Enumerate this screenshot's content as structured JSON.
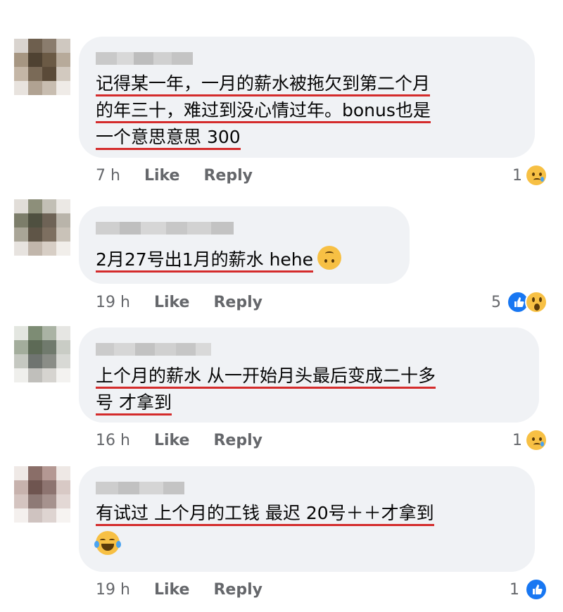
{
  "comments": [
    {
      "lines": [
        "记得某一年，一月的薪水被拖欠到第二个月",
        "的年三十，难过到没心情过年。bonus也是",
        "一个意思意思 300"
      ],
      "time": "7 h",
      "like": "Like",
      "reply": "Reply",
      "reaction_count": "1",
      "reactions": [
        "sad-reaction-icon"
      ]
    },
    {
      "lines": [
        "2月27号出1月的薪水 hehe"
      ],
      "inline_emoji": "upside-down-face-emoji",
      "time": "19 h",
      "like": "Like",
      "reply": "Reply",
      "reaction_count": "5",
      "reactions": [
        "like-reaction-icon",
        "wow-reaction-icon"
      ]
    },
    {
      "lines": [
        "上个月的薪水 从一开始月头最后变成二十多",
        "号 才拿到"
      ],
      "time": "16 h",
      "like": "Like",
      "reply": "Reply",
      "reaction_count": "1",
      "reactions": [
        "sad-reaction-icon"
      ]
    },
    {
      "lines": [
        "有试过 上个月的工钱 最迟 20号＋＋才拿到"
      ],
      "emoji_line": "tears-of-joy-emoji",
      "time": "19 h",
      "like": "Like",
      "reply": "Reply",
      "reaction_count": "1",
      "reactions": [
        "like-reaction-icon"
      ]
    }
  ],
  "colors": {
    "bubble": "#f0f2f5",
    "underline": "#d42b2b",
    "meta": "#65676b",
    "like_blue": "#1877f2",
    "reaction_yellow": "#f7c044"
  }
}
